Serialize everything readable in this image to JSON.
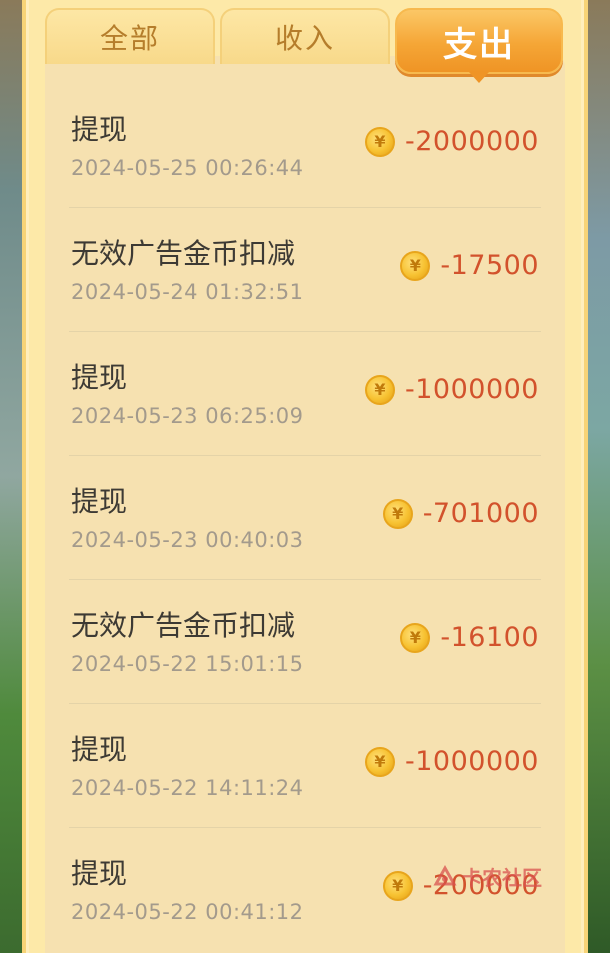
{
  "tabs": [
    {
      "label": "全部",
      "active": false
    },
    {
      "label": "收入",
      "active": false
    },
    {
      "label": "支出",
      "active": true
    }
  ],
  "records": [
    {
      "title": "提现",
      "time": "2024-05-25 00:26:44",
      "amount": "-2000000"
    },
    {
      "title": "无效广告金币扣减",
      "time": "2024-05-24 01:32:51",
      "amount": "-17500"
    },
    {
      "title": "提现",
      "time": "2024-05-23 06:25:09",
      "amount": "-1000000"
    },
    {
      "title": "提现",
      "time": "2024-05-23 00:40:03",
      "amount": "-701000"
    },
    {
      "title": "无效广告金币扣减",
      "time": "2024-05-22 15:01:15",
      "amount": "-16100"
    },
    {
      "title": "提现",
      "time": "2024-05-22 14:11:24",
      "amount": "-1000000"
    },
    {
      "title": "提现",
      "time": "2024-05-22 00:41:12",
      "amount": "-200000"
    }
  ],
  "coin_symbol": "¥",
  "watermark": {
    "text": "卡农社区"
  },
  "colors": {
    "active_tab": "#f5a636",
    "amount": "#d2522c",
    "panel": "#fde9a8"
  }
}
